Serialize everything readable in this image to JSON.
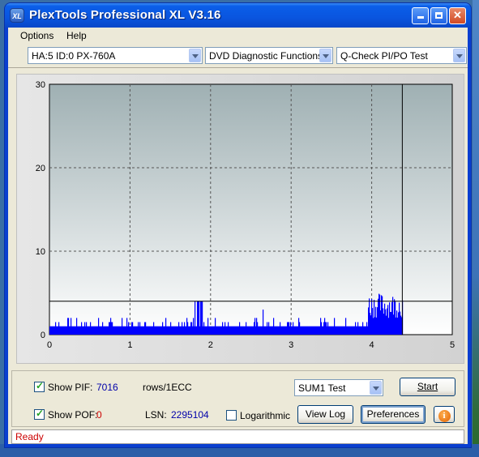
{
  "window": {
    "title": "PlexTools Professional XL V3.16",
    "app_icon_text": "XL"
  },
  "menu": {
    "items": [
      "Options",
      "Help"
    ]
  },
  "toolbar": {
    "drive": "HA:5 ID:0  PX-760A",
    "function": "DVD Diagnostic Functions",
    "test": "Q-Check PI/PO Test"
  },
  "controls": {
    "show_pif_label": "Show PIF:",
    "show_pif_checked": true,
    "pif_value": "7016",
    "pif_unit": "rows/1ECC",
    "show_pof_label": "Show POF:",
    "show_pof_checked": true,
    "pof_value": "0",
    "lsn_label": "LSN:",
    "lsn_value": "2295104",
    "logarithmic_label": "Logarithmic",
    "logarithmic_checked": false,
    "sum_select": "SUM1 Test",
    "start_label": "Start",
    "view_log_label": "View Log",
    "preferences_label": "Preferences",
    "info_icon": "info-icon"
  },
  "status": {
    "text": "Ready"
  },
  "colors": {
    "series": "#0000ff",
    "threshold": "#000000",
    "plot_bg_top": "#9fb0b3",
    "plot_bg_bottom": "#ffffff",
    "status_text": "#cc0000"
  },
  "chart_data": {
    "type": "bar",
    "xlim": [
      0,
      5
    ],
    "ylim": [
      0,
      30
    ],
    "xticks": [
      "0",
      "1",
      "2",
      "3",
      "4",
      "5"
    ],
    "yticks": [
      "0",
      "10",
      "20",
      "30"
    ],
    "grid": true,
    "threshold_y": 4,
    "test_end_x": 4.38,
    "series": [
      {
        "values_profile": [
          {
            "x_from": 0.0,
            "x_to": 0.4,
            "base": 1,
            "peak": 2
          },
          {
            "x_from": 0.4,
            "x_to": 1.8,
            "base": 1,
            "peak": 2
          },
          {
            "x_from": 1.8,
            "x_to": 1.9,
            "base": 1,
            "peak": 4
          },
          {
            "x_from": 1.9,
            "x_to": 2.6,
            "base": 1,
            "peak": 2
          },
          {
            "x_from": 2.6,
            "x_to": 2.65,
            "base": 1,
            "peak": 3
          },
          {
            "x_from": 2.65,
            "x_to": 3.95,
            "base": 1,
            "peak": 2
          },
          {
            "x_from": 3.95,
            "x_to": 4.38,
            "base": 2,
            "peak": 5
          }
        ]
      }
    ]
  }
}
